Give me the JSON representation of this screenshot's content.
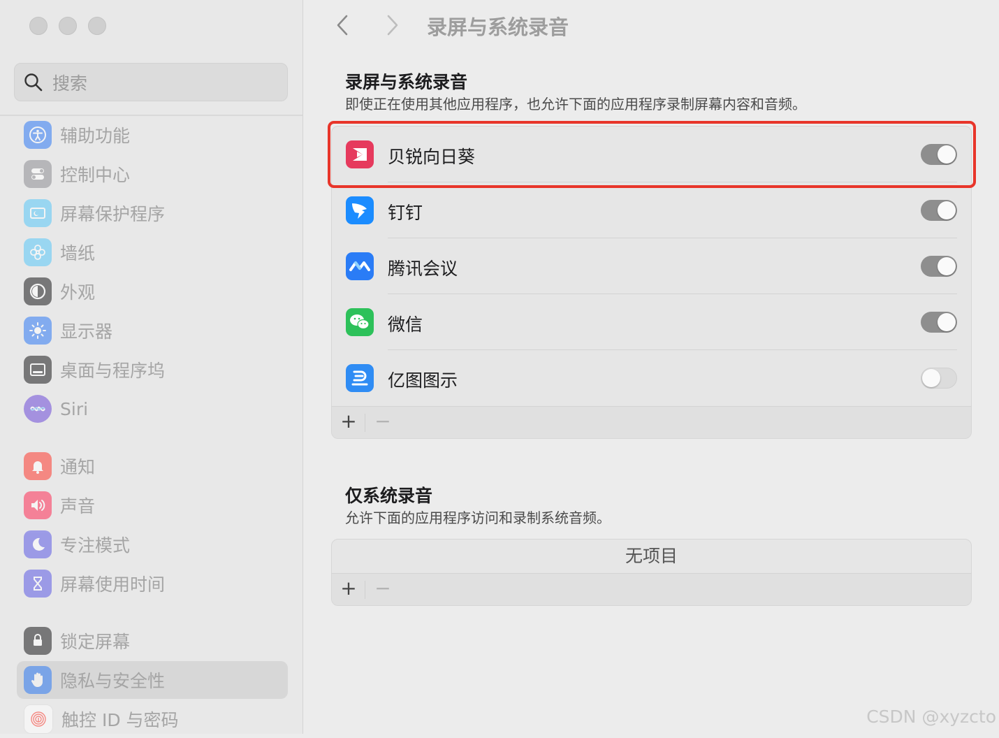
{
  "sidebar": {
    "search_placeholder": "搜索",
    "items": [
      {
        "label": "辅助功能",
        "icon": "accessibility-icon",
        "color": "#2f7bf5"
      },
      {
        "label": "控制中心",
        "icon": "control-center-icon",
        "color": "#8e8e93"
      },
      {
        "label": "屏幕保护程序",
        "icon": "screensaver-icon",
        "color": "#5ac8fa"
      },
      {
        "label": "墙纸",
        "icon": "wallpaper-icon",
        "color": "#5ac8fa"
      },
      {
        "label": "外观",
        "icon": "appearance-icon",
        "color": "#1c1c1e"
      },
      {
        "label": "显示器",
        "icon": "display-icon",
        "color": "#2f7bf5"
      },
      {
        "label": "桌面与程序坞",
        "icon": "dock-icon",
        "color": "#1c1c1e"
      },
      {
        "label": "Siri",
        "icon": "siri-icon",
        "color": "#6e4bd8"
      },
      {
        "label": "通知",
        "icon": "notification-icon",
        "color": "#ff3b30"
      },
      {
        "label": "声音",
        "icon": "sound-icon",
        "color": "#ff2d55"
      },
      {
        "label": "专注模式",
        "icon": "focus-moon-icon",
        "color": "#5e5ce6"
      },
      {
        "label": "屏幕使用时间",
        "icon": "hourglass-icon",
        "color": "#5e5ce6"
      },
      {
        "label": "锁定屏幕",
        "icon": "lock-icon",
        "color": "#1c1c1e"
      },
      {
        "label": "隐私与安全性",
        "icon": "privacy-hand-icon",
        "color": "#2f7bf5",
        "selected": true
      },
      {
        "label": "触控 ID 与密码",
        "icon": "fingerprint-icon",
        "color": "#ff3b30"
      }
    ]
  },
  "header": {
    "title": "录屏与系统录音"
  },
  "screen_recording": {
    "title": "录屏与系统录音",
    "description": "即使正在使用其他应用程序，也允许下面的应用程序录制屏幕内容和音频。",
    "apps": [
      {
        "name": "贝锐向日葵",
        "icon": "sunlogin-icon",
        "enabled": true
      },
      {
        "name": "钉钉",
        "icon": "dingtalk-icon",
        "enabled": true
      },
      {
        "name": "腾讯会议",
        "icon": "tencent-meeting-icon",
        "enabled": true
      },
      {
        "name": "微信",
        "icon": "wechat-icon",
        "enabled": true
      },
      {
        "name": "亿图图示",
        "icon": "edraw-icon",
        "enabled": false
      }
    ],
    "add_label": "+",
    "remove_label": "−"
  },
  "system_audio": {
    "title": "仅系统录音",
    "description": "允许下面的应用程序访问和录制系统音频。",
    "empty_text": "无项目",
    "add_label": "+",
    "remove_label": "−"
  },
  "watermark": "CSDN @xyzcto",
  "colors": {
    "highlight": "#e8352a",
    "toggle_on": "#8e8e8e",
    "toggle_off": "#dcdcdc"
  }
}
